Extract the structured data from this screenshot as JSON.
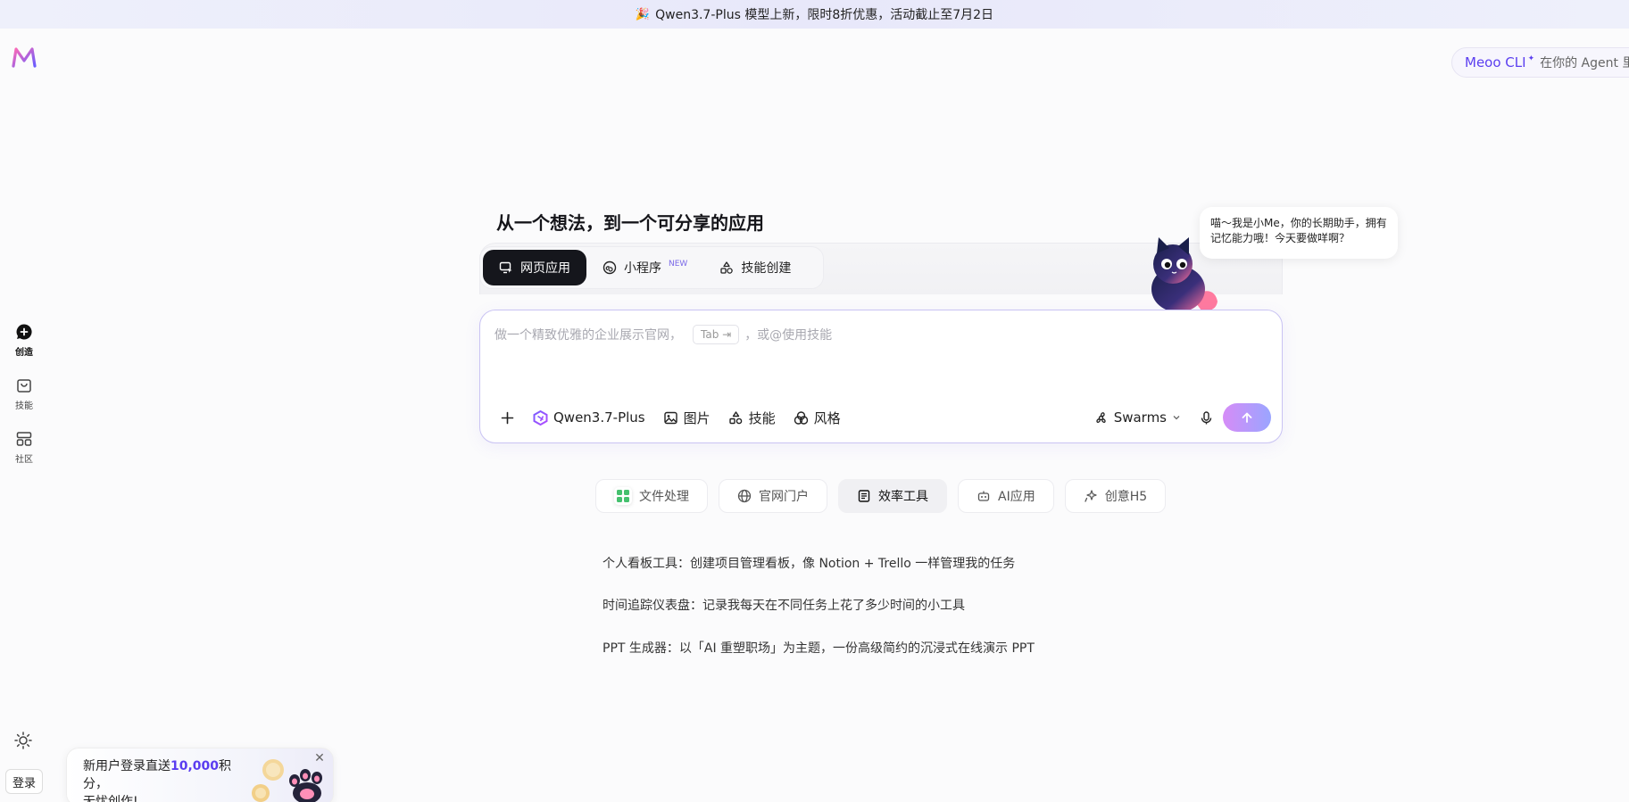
{
  "banner": {
    "text": "Qwen3.7-Plus 模型上新，限时8折优惠，活动截止至7月2日",
    "icon": "party-popper-icon"
  },
  "sidebar": {
    "items": [
      {
        "label": "创造",
        "icon": "chat-plus-icon",
        "active": true
      },
      {
        "label": "技能",
        "icon": "bag-icon",
        "active": false
      },
      {
        "label": "社区",
        "icon": "grid-icon",
        "active": false
      }
    ],
    "login_label": "登录"
  },
  "cli": {
    "name": "Meoo CLI",
    "desc": "在你的 Agent 里"
  },
  "hero": {
    "title": "从一个想法，到一个可分享的应用"
  },
  "tabs": [
    {
      "label": "网页应用",
      "active": true,
      "badge": ""
    },
    {
      "label": "小程序",
      "active": false,
      "badge": "NEW"
    },
    {
      "label": "技能创建",
      "active": false,
      "badge": ""
    }
  ],
  "input": {
    "placeholder_before": "做一个精致优雅的企业展示官网，",
    "tab_key": "Tab ⇥",
    "placeholder_after": "，或@使用技能",
    "model": "Qwen3.7-Plus",
    "image_label": "图片",
    "skill_label": "技能",
    "style_label": "风格",
    "mode": "Swarms"
  },
  "mascot": {
    "bubble_text": "喵～我是小Me，你的长期助手，拥有记忆能力哦！今天要做咩啊？"
  },
  "chips": [
    {
      "label": "文件处理",
      "active": false
    },
    {
      "label": "官网门户",
      "active": false
    },
    {
      "label": "效率工具",
      "active": true
    },
    {
      "label": "AI应用",
      "active": false
    },
    {
      "label": "创意H5",
      "active": false
    }
  ],
  "suggestions": [
    "个人看板工具：创建项目管理看板，像 Notion + Trello 一样管理我的任务",
    "时间追踪仪表盘：记录我每天在不同任务上花了多少时间的小工具",
    "PPT 生成器：以「AI 重塑职场」为主题，一份高级简约的沉浸式在线演示 PPT"
  ],
  "promo": {
    "line1_before": "新用户登录直送",
    "line1_highlight": "10,000",
    "line1_after": "积分，",
    "line2": "无忧创作!"
  },
  "colors": {
    "accent": "#5b3ff0",
    "tab_active_bg": "#15161c",
    "input_border": "#c9c3f3"
  }
}
